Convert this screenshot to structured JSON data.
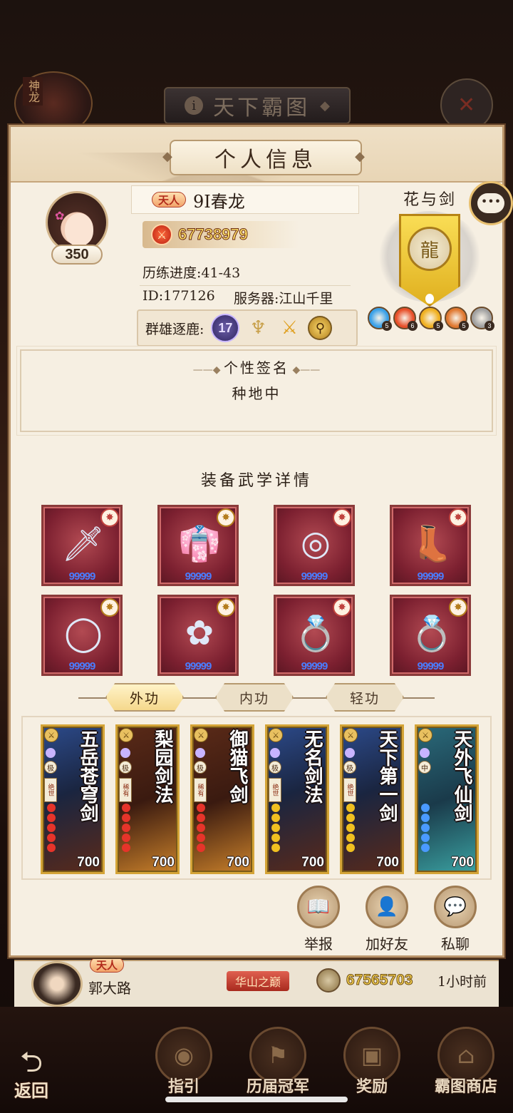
{
  "background": {
    "screen_title": "天下霸图",
    "corner_badge": "神龙",
    "list_row": {
      "title_badge": "天人",
      "player_name": "郭大路",
      "server_tag": "华山之巅",
      "power": "67565703",
      "time": "1小时前"
    },
    "nav": {
      "back": "返回",
      "guide": "指引",
      "champions": "历届冠军",
      "rewards": "奖励",
      "shop": "霸图商店"
    }
  },
  "dialog": {
    "title": "个人信息",
    "player": {
      "level": "350",
      "title_badge": "天人",
      "name": "9I春龙",
      "power": "67738979",
      "progress": "历练进度:41-43",
      "id": "ID:177126",
      "server": "服务器:江山千里",
      "rank_label": "群雄逐鹿:",
      "rank_value": "17"
    },
    "guild": {
      "name": "花与剑",
      "elements": [
        {
          "icon": "water-element-icon",
          "level": "5",
          "color": "#3aa0e8"
        },
        {
          "icon": "fire-element-icon",
          "level": "6",
          "color": "#e8502a"
        },
        {
          "icon": "gold-element-icon",
          "level": "5",
          "color": "#f0b020"
        },
        {
          "icon": "flame-element-icon",
          "level": "5",
          "color": "#e07830"
        },
        {
          "icon": "metal-element-icon",
          "level": "3",
          "color": "#a0a0a0"
        }
      ]
    },
    "signature": {
      "title": "个性签名",
      "text": "种地中"
    },
    "equipment": {
      "title": "装备武学详情",
      "items": [
        {
          "icon": "sword-icon",
          "gems": "99999"
        },
        {
          "icon": "robe-icon",
          "gems": "99999"
        },
        {
          "icon": "belt-icon",
          "gems": "99999"
        },
        {
          "icon": "boots-icon",
          "gems": "99999"
        },
        {
          "icon": "necklace-icon",
          "gems": "99999"
        },
        {
          "icon": "hairpin-icon",
          "gems": "99999"
        },
        {
          "icon": "gold-ring-icon",
          "gems": "99999"
        },
        {
          "icon": "silver-ring-icon",
          "gems": "99999"
        }
      ]
    },
    "tabs": [
      "外功",
      "内功",
      "轻功"
    ],
    "skills": [
      {
        "name": "五岳苍穹剑",
        "grade": "极",
        "rarity": "绝世",
        "level": "700"
      },
      {
        "name": "梨园剑法",
        "grade": "极",
        "rarity": "稀有",
        "level": "700"
      },
      {
        "name": "御猫飞剑",
        "grade": "极",
        "rarity": "稀有",
        "level": "700"
      },
      {
        "name": "无名剑法",
        "grade": "极",
        "rarity": "绝世",
        "level": "700"
      },
      {
        "name": "天下第一剑",
        "grade": "极",
        "rarity": "绝世",
        "level": "700"
      },
      {
        "name": "天外飞仙剑",
        "grade": "中",
        "rarity": "",
        "level": "700"
      }
    ],
    "actions": {
      "report": "举报",
      "add_friend": "加好友",
      "private_chat": "私聊"
    }
  }
}
